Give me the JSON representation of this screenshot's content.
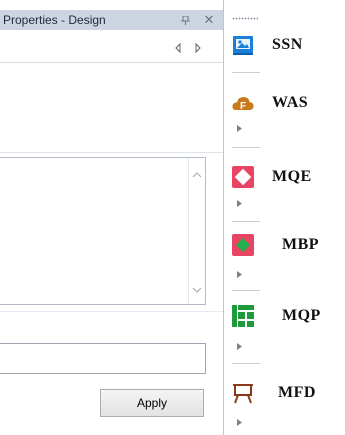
{
  "properties_panel": {
    "title": "Properties - Design",
    "pin_glyph": "⌲",
    "close_glyph": "✕",
    "text_value": "",
    "input_value": "",
    "apply_label": "Apply"
  },
  "toolbox": {
    "items": [
      {
        "label": "SSN",
        "icon": "monitor-image-icon",
        "color": "#1a7fd8"
      },
      {
        "label": "WAS",
        "icon": "cloud-f-icon",
        "color": "#c87a1a"
      },
      {
        "label": "MQE",
        "icon": "diamond-pattern-icon",
        "color": "#e84565"
      },
      {
        "label": "MBP",
        "icon": "green-diamond-icon",
        "color": "#e84565"
      },
      {
        "label": "MQP",
        "icon": "green-grid-icon",
        "color": "#1f9a3a"
      },
      {
        "label": "MFD",
        "icon": "easel-icon",
        "color": "#8a3a1a"
      }
    ]
  }
}
